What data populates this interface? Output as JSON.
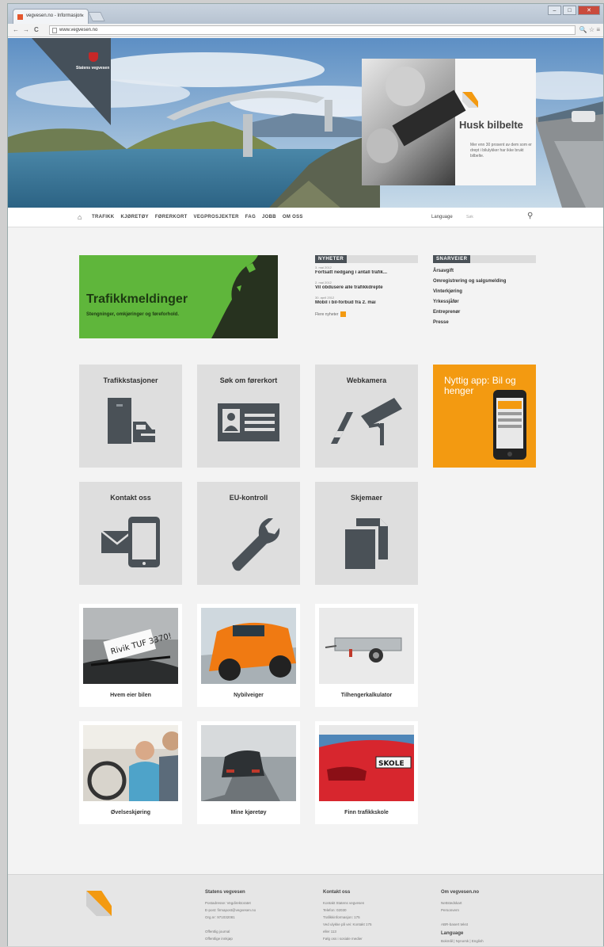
{
  "browser": {
    "tab_title": "vegvesen.no - Informasjon",
    "tab_close": "×",
    "url": "www.vegvesen.no",
    "window_controls": [
      "–",
      "□",
      "✕"
    ],
    "nav_icons": [
      "←",
      "→",
      "C"
    ],
    "addr_icons": "🔍 ☆ ≡"
  },
  "header": {
    "logo_text": "Statens vegvesen",
    "promo_title": "Husk bilbelte",
    "promo_text": "Mer enn 30 prosent av dem som er drept i bilulykker har ikke brukt bilbelte."
  },
  "nav": {
    "home_icon": "⌂",
    "items": [
      "TRAFIKK",
      "KJØRETØY",
      "FØRERKORT",
      "VEGPROSJEKTER",
      "FAG",
      "JOBB",
      "OM OSS"
    ],
    "language": "Language",
    "search_placeholder": "Søk",
    "search_icon": "⚲"
  },
  "trafikk": {
    "title": "Trafikkmeldinger",
    "subtitle": "Stengninger, omkjøringer og føreforhold."
  },
  "news": {
    "heading": "NYHETER",
    "items": [
      {
        "date": "3. mai 2012",
        "title": "Fortsatt nedgang i antall trafik..."
      },
      {
        "date": "2. mai 2012",
        "title": "Vil obdusere alle trafikkdrepte"
      },
      {
        "date": "30. april 2012",
        "title": "Mobil i bil-forbud fra 2. mai"
      }
    ],
    "more": "Flere nyheter"
  },
  "shortcuts": {
    "heading": "SNARVEIER",
    "items": [
      "Årsavgift",
      "Omregistrering og salgsmelding",
      "Vinterkjøring",
      "Yrkessjåfør",
      "Entreprenør",
      "Presse"
    ]
  },
  "tiles": {
    "t1": "Trafikkstasjoner",
    "t2": "Søk om førerkort",
    "t3": "Webkamera",
    "t4": "Kontakt oss",
    "t5": "EU-kontroll",
    "t6": "Skjemaer",
    "app": "Nyttig app: Bil og henger"
  },
  "photo_tiles": {
    "p1": "Hvem eier bilen",
    "p2": "Nybilveiger",
    "p3": "Tilhengerkalkulator",
    "p4": "Øvelseskjøring",
    "p5": "Mine kjøretøy",
    "p6": "Finn trafikkskole",
    "note_text": "Rivik TUF 3370!",
    "school_sign": "SKOLE"
  },
  "footer": {
    "c1_title": "Statens vegvesen",
    "c1_lines": [
      "Postadresse: Vegdirektoratet",
      "E-post: firmapost@vegvesen.no",
      "Org.nr: 971032081",
      "",
      "Offentlig journal",
      "Offentlige innkjøp"
    ],
    "c2_title": "Kontakt oss",
    "c2_lines": [
      "Kontakt Statens vegvesen",
      "Telefon: 02030",
      "Trafikkinformasjon: 175",
      "Ved ulykke på vei: Kontakt 175",
      "eller 113",
      "Følg oss i sosiale medier"
    ],
    "c3_title": "Om vegvesen.no",
    "c3_lines": [
      "Nettstedskart",
      "Personvern",
      "",
      "ABR-basert tekst"
    ],
    "c3_sub": "Language",
    "c3_lang": "Bokmål | Nynorsk | English"
  },
  "colors": {
    "green": "#5fb63b",
    "orange": "#f39a11",
    "dark": "#4a5157",
    "tile": "#dedede"
  }
}
